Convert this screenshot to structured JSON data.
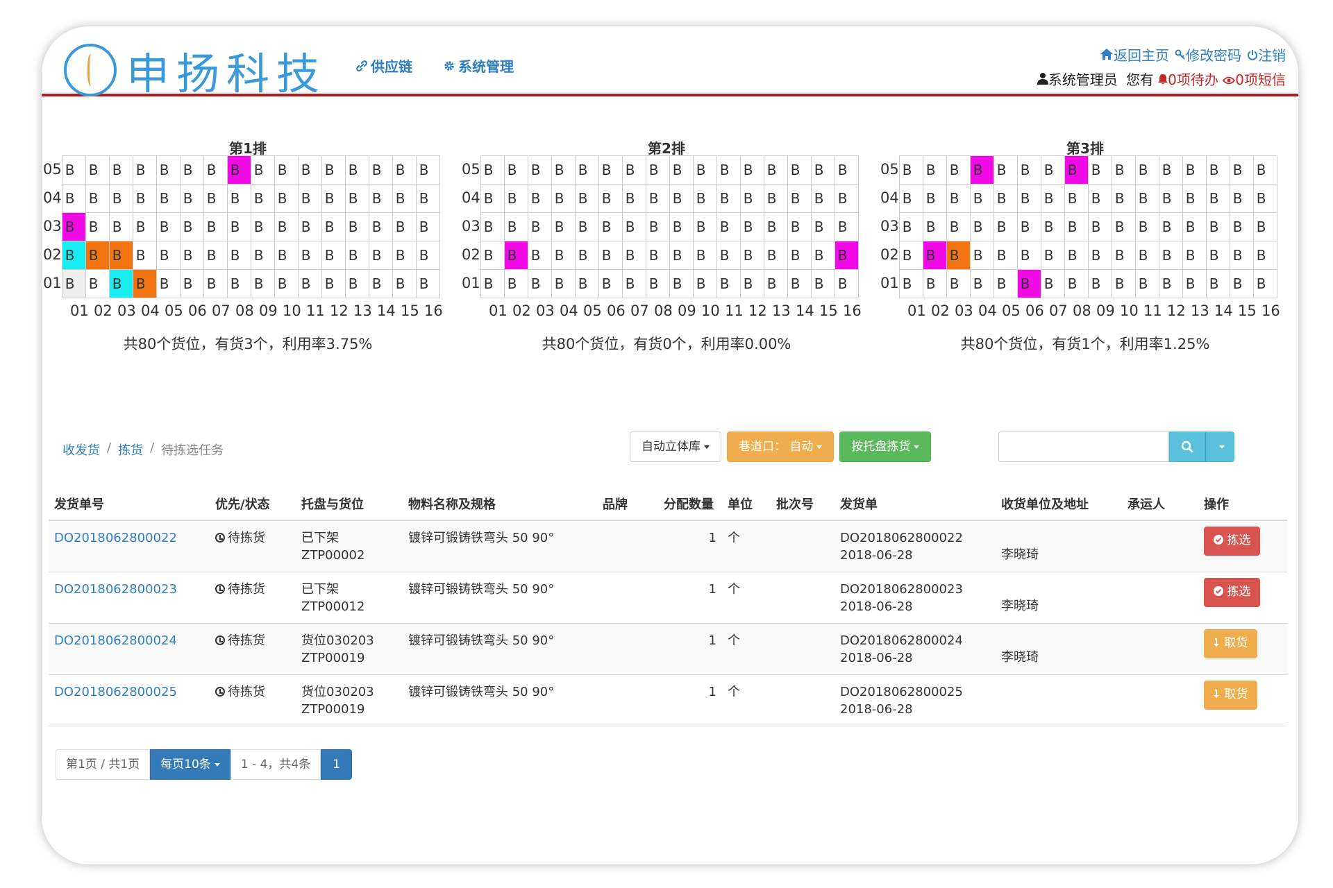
{
  "header": {
    "logo_text": "申扬科技",
    "nav": [
      {
        "label": "供应链",
        "icon": "link-icon"
      },
      {
        "label": "系统管理",
        "icon": "gear-icon"
      }
    ],
    "links": {
      "home": "返回主页",
      "password": "修改密码",
      "logout": "注销"
    },
    "user": "系统管理员",
    "you_have": "您有",
    "todo": "0项待办",
    "sms": "0项短信"
  },
  "racks": [
    {
      "title": "第1排",
      "rows": [
        "05",
        "04",
        "03",
        "02",
        "01"
      ],
      "cols": [
        "01",
        "02",
        "03",
        "04",
        "05",
        "06",
        "07",
        "08",
        "09",
        "10",
        "11",
        "12",
        "13",
        "14",
        "15",
        "16"
      ],
      "cell_text": "B",
      "highlights": {
        "0": {
          "7": "magenta"
        },
        "2": {
          "0": "magenta"
        },
        "3": {
          "0": "cyan",
          "1": "orange",
          "2": "orange"
        },
        "4": {
          "0": "gray",
          "2": "cyan",
          "3": "orange"
        }
      },
      "summary": "共80个货位，有货3个，利用率3.75%"
    },
    {
      "title": "第2排",
      "rows": [
        "05",
        "04",
        "03",
        "02",
        "01"
      ],
      "cols": [
        "01",
        "02",
        "03",
        "04",
        "05",
        "06",
        "07",
        "08",
        "09",
        "10",
        "11",
        "12",
        "13",
        "14",
        "15",
        "16"
      ],
      "cell_text": "B",
      "highlights": {
        "3": {
          "1": "magenta",
          "15": "magenta"
        }
      },
      "summary": "共80个货位，有货0个，利用率0.00%"
    },
    {
      "title": "第3排",
      "rows": [
        "05",
        "04",
        "03",
        "02",
        "01"
      ],
      "cols": [
        "01",
        "02",
        "03",
        "04",
        "05",
        "06",
        "07",
        "08",
        "09",
        "10",
        "11",
        "12",
        "13",
        "14",
        "15",
        "16"
      ],
      "cell_text": "B",
      "highlights": {
        "0": {
          "3": "magenta",
          "7": "magenta"
        },
        "3": {
          "1": "magenta",
          "2": "orange"
        },
        "4": {
          "5": "magenta"
        }
      },
      "summary": "共80个货位，有货1个，利用率1.25%"
    }
  ],
  "colors": {
    "magenta": "#f20ae6",
    "orange": "#f27512",
    "cyan": "#18eef2",
    "gray": "#eeeeee"
  },
  "breadcrumb": [
    "收发货",
    "拣货",
    "待拣选任务"
  ],
  "toolbar": {
    "warehouse": "自动立体库",
    "aisle": "巷道口：  自动",
    "pick": "按托盘拣货"
  },
  "search": {
    "placeholder": "",
    "value": ""
  },
  "table": {
    "headers": [
      "发货单号",
      "优先/状态",
      "托盘与货位",
      "物料名称及规格",
      "品牌",
      "分配数量",
      "单位",
      "批次号",
      "发货单",
      "收货单位及地址",
      "承运人",
      "操作"
    ],
    "rows": [
      {
        "order": "DO2018062800022",
        "status": "待拣货",
        "loc1": "已下架",
        "loc2": "ZTP00002",
        "material": "镀锌可锻铸铁弯头 50 90°",
        "brand": "",
        "qty": "1",
        "unit": "个",
        "batch": "",
        "doc1": "DO2018062800022",
        "doc2": "2018-06-28",
        "receiver": "李晓琦",
        "carrier": "",
        "action": "拣选",
        "action_type": "danger"
      },
      {
        "order": "DO2018062800023",
        "status": "待拣货",
        "loc1": "已下架",
        "loc2": "ZTP00012",
        "material": "镀锌可锻铸铁弯头 50 90°",
        "brand": "",
        "qty": "1",
        "unit": "个",
        "batch": "",
        "doc1": "DO2018062800023",
        "doc2": "2018-06-28",
        "receiver": "李晓琦",
        "carrier": "",
        "action": "拣选",
        "action_type": "danger"
      },
      {
        "order": "DO2018062800024",
        "status": "待拣货",
        "loc1": "货位030203",
        "loc2": "ZTP00019",
        "material": "镀锌可锻铸铁弯头 50 90°",
        "brand": "",
        "qty": "1",
        "unit": "个",
        "batch": "",
        "doc1": "DO2018062800024",
        "doc2": "2018-06-28",
        "receiver": "李晓琦",
        "carrier": "",
        "action": "取货",
        "action_type": "warning"
      },
      {
        "order": "DO2018062800025",
        "status": "待拣货",
        "loc1": "货位030203",
        "loc2": "ZTP00019",
        "material": "镀锌可锻铸铁弯头 50 90°",
        "brand": "",
        "qty": "1",
        "unit": "个",
        "batch": "",
        "doc1": "DO2018062800025",
        "doc2": "2018-06-28",
        "receiver": "",
        "carrier": "",
        "action": "取货",
        "action_type": "warning"
      }
    ]
  },
  "pager": {
    "page_info": "第1页 / 共1页",
    "per_page": "每页10条",
    "range": "1 - 4，共4条",
    "current": "1"
  }
}
